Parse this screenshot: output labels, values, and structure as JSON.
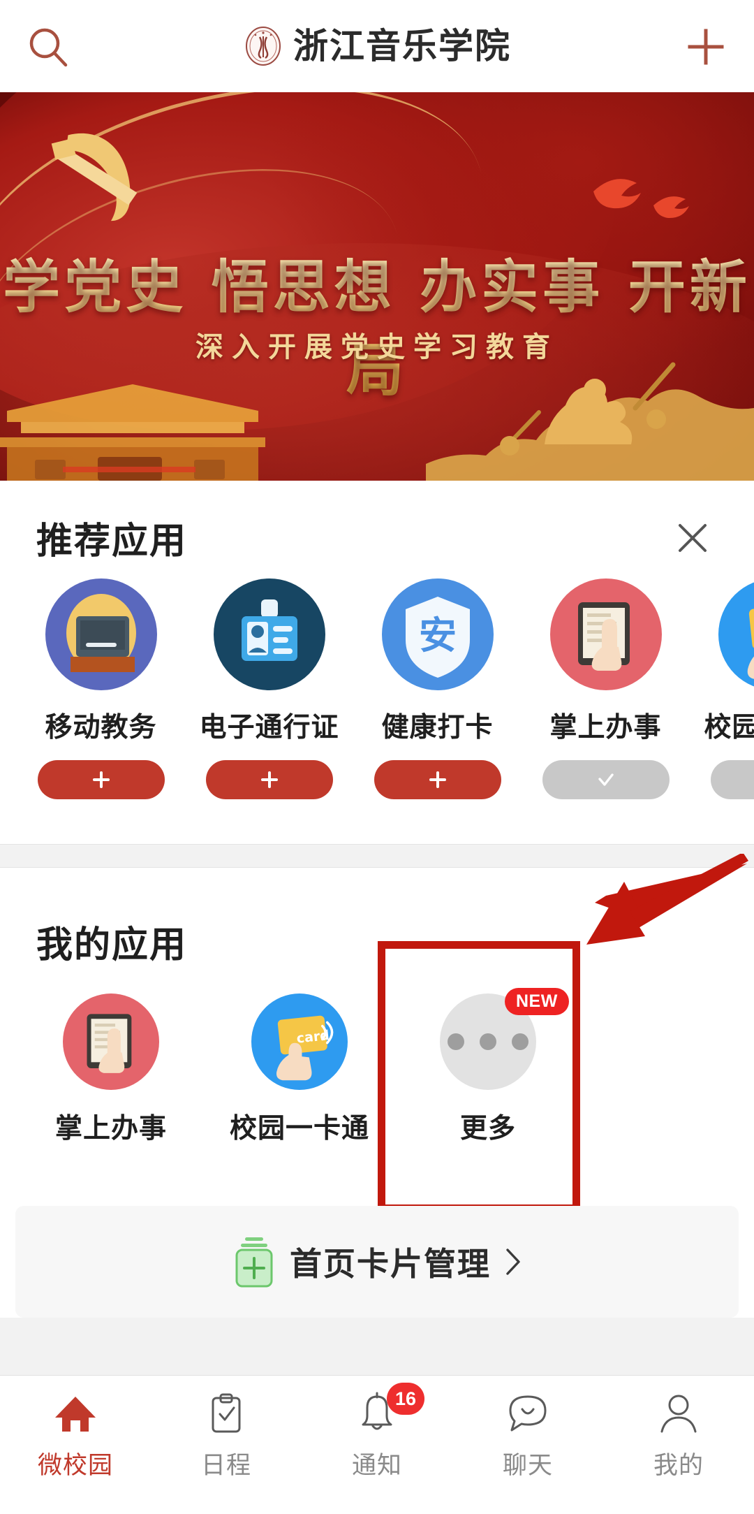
{
  "header": {
    "title": "浙江音乐学院",
    "search_icon": "search-icon",
    "logo_icon": "university-seal-logo",
    "add_icon": "plus-icon"
  },
  "banner": {
    "main_text": "学党史 悟思想 办实事 开新局",
    "sub_text": "深入开展党史学习教育",
    "emblem_icon": "hammer-sickle-party-emblem",
    "doves_icon": "doves-icon",
    "tower_icon": "tiananmen-gate-icon",
    "heroes_icon": "heroes-monument-icon",
    "colors": {
      "gold": "#f0c674",
      "red_dark": "#5c0806",
      "red_mid": "#9e1410"
    }
  },
  "recommended": {
    "title": "推荐应用",
    "close_icon": "close-icon",
    "apps": [
      {
        "label": "移动教务",
        "icon": "computer-desktop-icon",
        "action": "add",
        "action_icon": "plus-icon",
        "bg": "#5a68bd"
      },
      {
        "label": "电子通行证",
        "icon": "id-card-icon",
        "action": "add",
        "action_icon": "plus-icon",
        "bg": "#174663"
      },
      {
        "label": "健康打卡",
        "icon": "shield-safe-icon",
        "action": "add",
        "action_icon": "plus-icon",
        "bg": "#4a90e2"
      },
      {
        "label": "掌上办事",
        "icon": "tablet-hand-icon",
        "action": "added",
        "action_icon": "check-icon",
        "bg": "#e4646b"
      },
      {
        "label": "校园一卡通",
        "icon": "campus-card-icon",
        "action": "added",
        "action_icon": "check-icon",
        "bg": "#2e9bf0"
      }
    ],
    "add_button_color": "#c0392b",
    "added_button_color": "#c8c8c8"
  },
  "my_apps": {
    "title": "我的应用",
    "apps": [
      {
        "label": "掌上办事",
        "icon": "tablet-hand-icon",
        "bg": "#e4646b",
        "badge": ""
      },
      {
        "label": "校园一卡通",
        "icon": "campus-card-icon",
        "bg": "#2e9bf0",
        "badge": ""
      },
      {
        "label": "更多",
        "icon": "more-dots-icon",
        "bg": "#e2e2e2",
        "badge": "NEW"
      }
    ],
    "badge_color": "#ee2222"
  },
  "annotations": {
    "highlight_box_color": "#c1180d",
    "arrow_color": "#c1180d",
    "arrow_icon": "annotation-arrow-icon",
    "target_label": "更多"
  },
  "card_management": {
    "label": "首页卡片管理",
    "icon": "stacked-cards-plus-icon",
    "chevron_icon": "chevron-right-icon",
    "icon_color": "#62c462"
  },
  "tabbar": {
    "items": [
      {
        "label": "微校园",
        "icon": "home-icon",
        "active": true,
        "badge": ""
      },
      {
        "label": "日程",
        "icon": "clipboard-check-icon",
        "active": false,
        "badge": ""
      },
      {
        "label": "通知",
        "icon": "bell-icon",
        "active": false,
        "badge": "16"
      },
      {
        "label": "聊天",
        "icon": "chat-bubble-icon",
        "active": false,
        "badge": ""
      },
      {
        "label": "我的",
        "icon": "person-icon",
        "active": false,
        "badge": ""
      }
    ],
    "active_color": "#c0392b",
    "inactive_color": "#8a8a8a",
    "badge_color": "#ee2e2e"
  }
}
